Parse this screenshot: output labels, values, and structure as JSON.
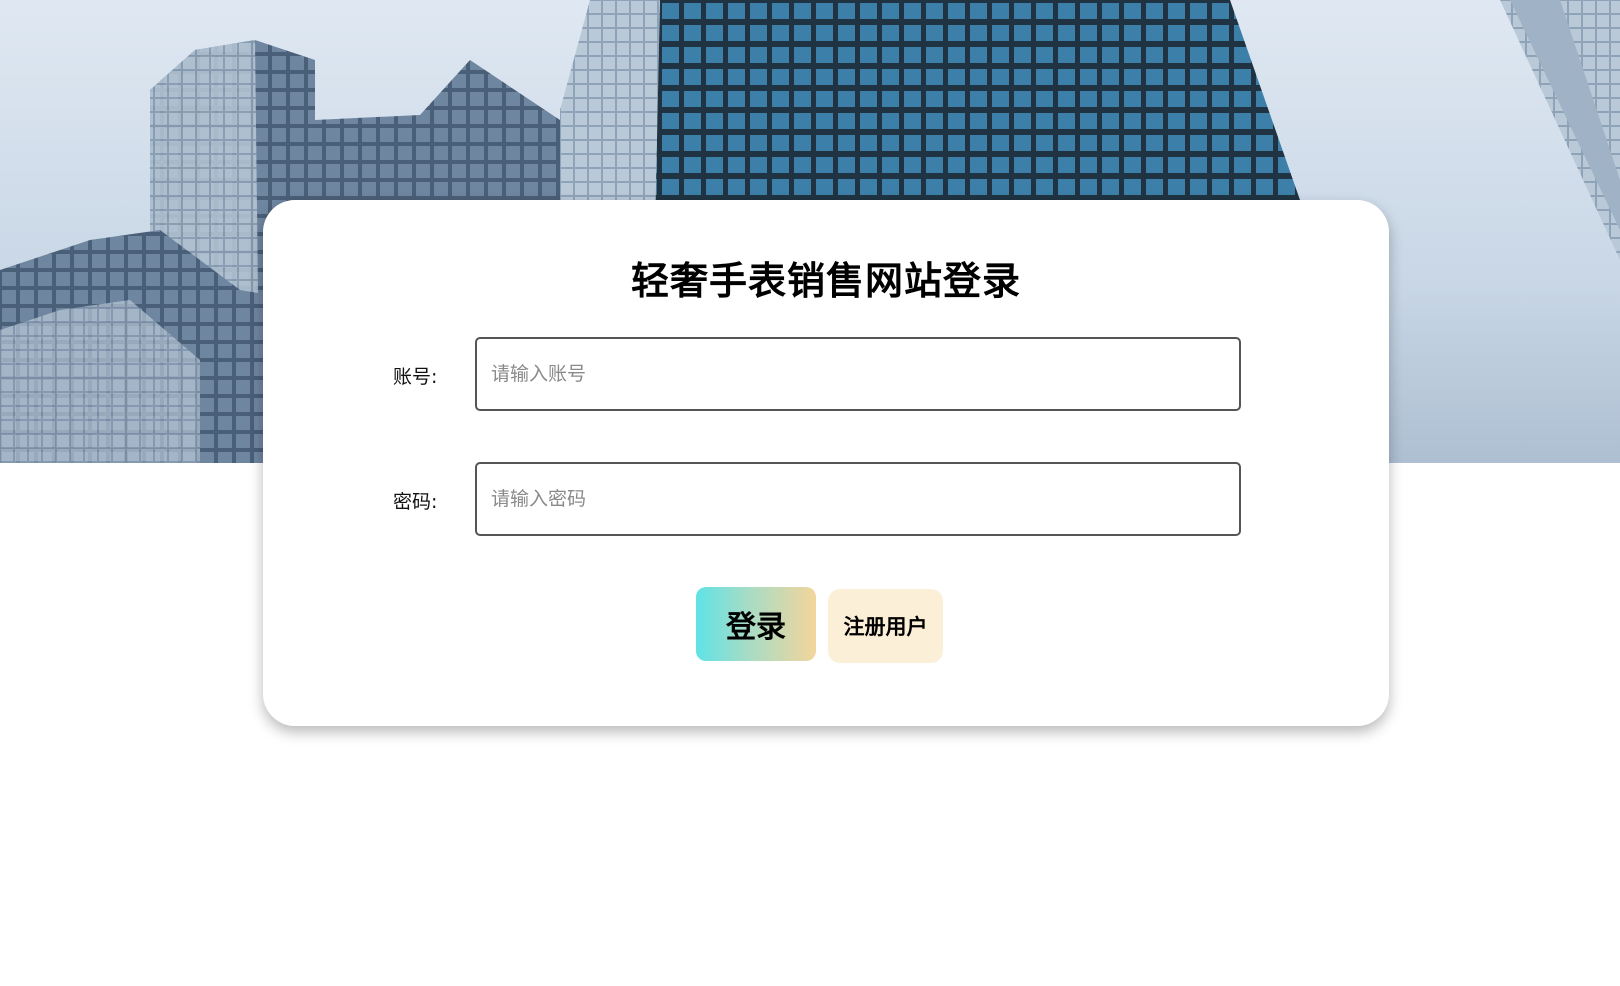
{
  "login": {
    "title": "轻奢手表销售网站登录",
    "account_label": "账号:",
    "account_placeholder": "请输入账号",
    "password_label": "密码:",
    "password_placeholder": "请输入密码",
    "login_button": "登录",
    "register_button": "注册用户"
  },
  "colors": {
    "login_gradient_start": "#5fe2e6",
    "login_gradient_end": "#f3d59b",
    "register_bg": "#fcefd8"
  }
}
